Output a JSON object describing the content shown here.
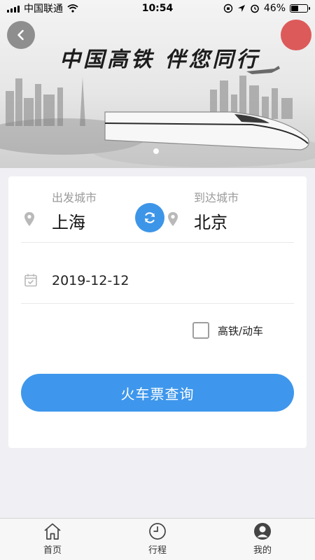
{
  "status_bar": {
    "carrier": "中国联通",
    "time": "10:54",
    "battery_percent": "46%",
    "battery_level": 0.46,
    "icons": [
      "signal-icon",
      "wifi-icon",
      "orientation-lock-icon",
      "location-icon",
      "alarm-icon",
      "battery-icon"
    ]
  },
  "banner": {
    "title": "中国高铁  伴您同行",
    "back_icon": "chevron-left-icon",
    "page_indicator": {
      "count": 1,
      "active": 1
    }
  },
  "form": {
    "from_label": "出发城市",
    "from_city": "上海",
    "to_label": "到达城市",
    "to_city": "北京",
    "swap_icon": "refresh-icon",
    "date": "2019-12-12",
    "highspeed_label": "高铁/动车",
    "highspeed_checked": false,
    "query_button": "火车票查询"
  },
  "colors": {
    "accent": "#3e97ec",
    "background": "#efeff4",
    "card": "#ffffff"
  },
  "tabs": [
    {
      "label": "首页",
      "icon": "home-icon"
    },
    {
      "label": "行程",
      "icon": "clock-icon"
    },
    {
      "label": "我的",
      "icon": "user-icon"
    }
  ]
}
